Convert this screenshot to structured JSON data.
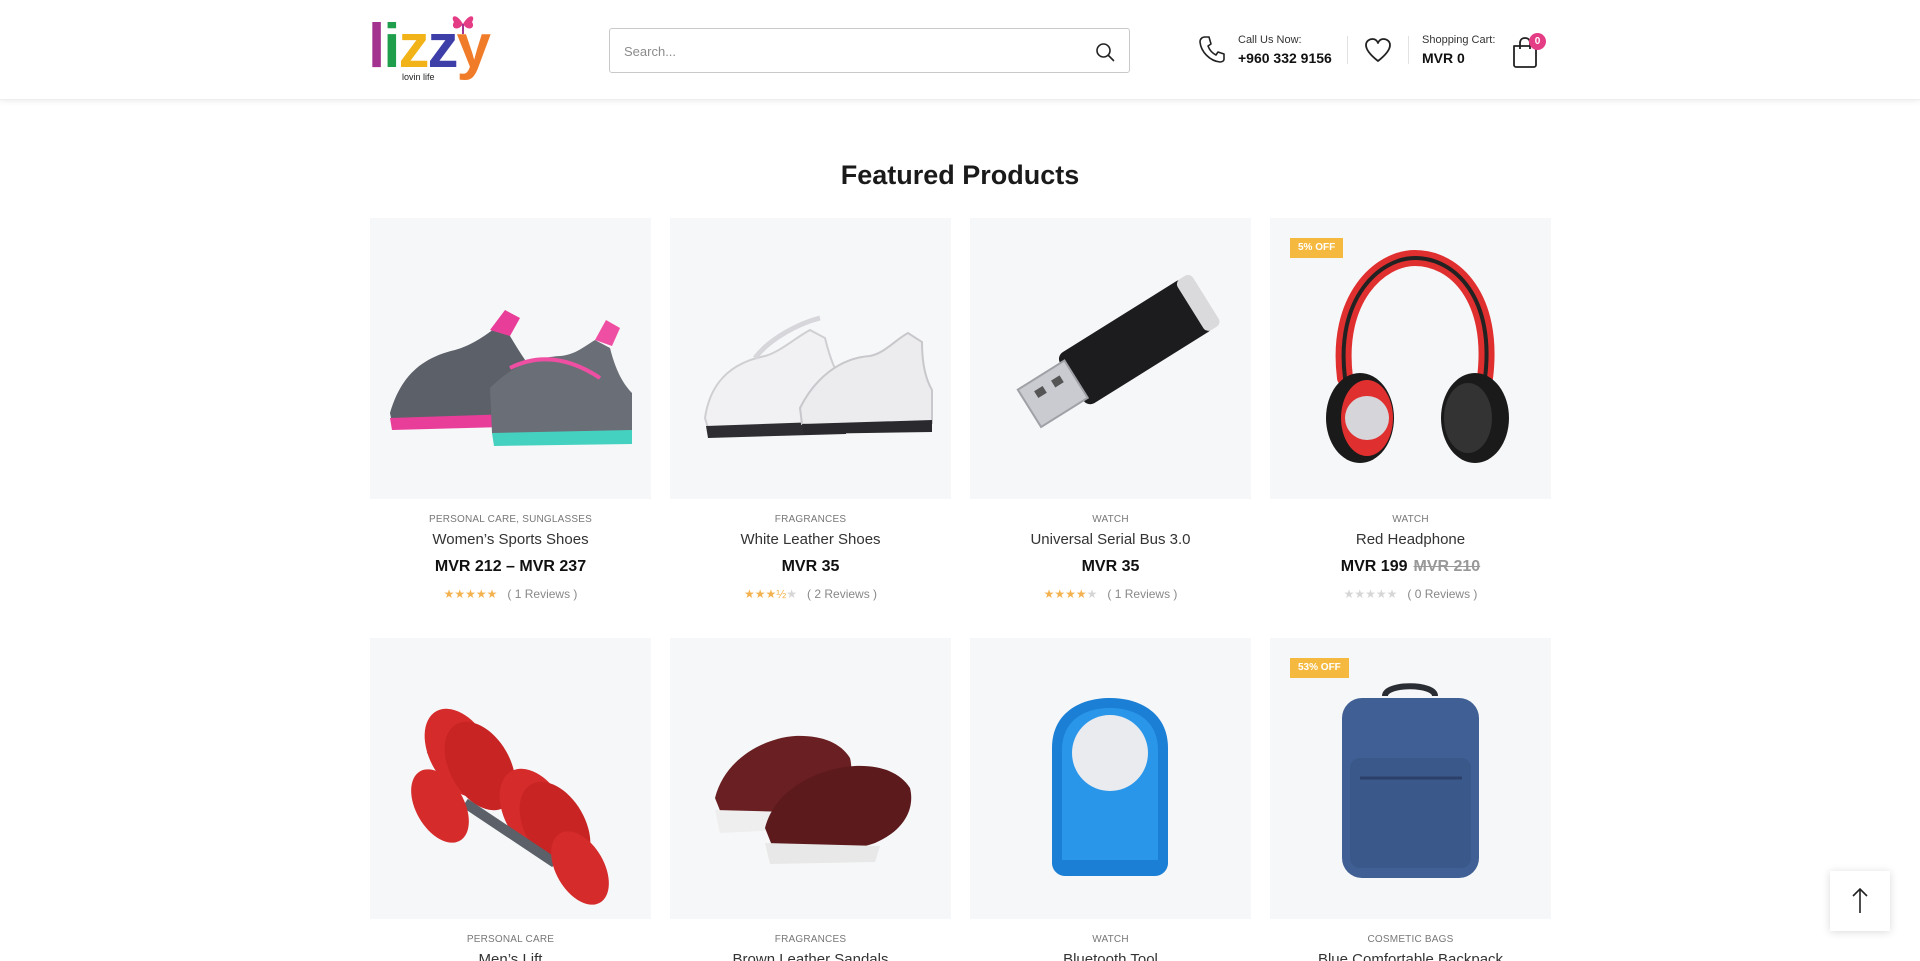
{
  "header": {
    "logo_text": "lizzy",
    "logo_tagline": "lovin life",
    "search_placeholder": "Search...",
    "call_label": "Call Us Now:",
    "call_number": "+960 332 9156",
    "cart_label": "Shopping Cart:",
    "cart_total": "MVR  0",
    "cart_count": "0"
  },
  "section": {
    "title": "Featured Products"
  },
  "products": [
    {
      "category": "PERSONAL CARE, SUNGLASSES",
      "name": "Women’s Sports Shoes",
      "price": "MVR  212 – MVR  237",
      "old_price": "",
      "rating": 5,
      "reviews": "( 1 Reviews )",
      "badge": "",
      "icon": "sports-shoes-image"
    },
    {
      "category": "FRAGRANCES",
      "name": "White Leather Shoes",
      "price": "MVR  35",
      "old_price": "",
      "rating": 3.5,
      "reviews": "( 2 Reviews )",
      "badge": "",
      "icon": "white-shoes-image"
    },
    {
      "category": "WATCH",
      "name": "Universal Serial Bus 3.0",
      "price": "MVR  35",
      "old_price": "",
      "rating": 4,
      "reviews": "( 1 Reviews )",
      "badge": "",
      "icon": "usb-drive-image"
    },
    {
      "category": "WATCH",
      "name": "Red Headphone",
      "price": "MVR  199",
      "old_price": "MVR  210",
      "rating": 0,
      "reviews": "( 0 Reviews )",
      "badge": "5% OFF",
      "icon": "headphone-image"
    },
    {
      "category": "PERSONAL CARE",
      "name": "Men’s Lift",
      "price": "",
      "old_price": "",
      "rating": null,
      "reviews": "",
      "badge": "",
      "icon": "dumbbell-image"
    },
    {
      "category": "FRAGRANCES",
      "name": "Brown Leather Sandals",
      "price": "",
      "old_price": "",
      "rating": null,
      "reviews": "",
      "badge": "",
      "icon": "brown-shoes-image"
    },
    {
      "category": "WATCH",
      "name": "Bluetooth Tool",
      "price": "",
      "old_price": "",
      "rating": null,
      "reviews": "",
      "badge": "",
      "icon": "bluetooth-device-image"
    },
    {
      "category": "COSMETIC BAGS",
      "name": "Blue Comfortable Backpack",
      "price": "",
      "old_price": "",
      "rating": null,
      "reviews": "",
      "badge": "53% OFF",
      "icon": "backpack-image"
    }
  ],
  "colors": {
    "accent": "#e53c86",
    "badge": "#f5b93f",
    "star": "#f3b24f"
  }
}
